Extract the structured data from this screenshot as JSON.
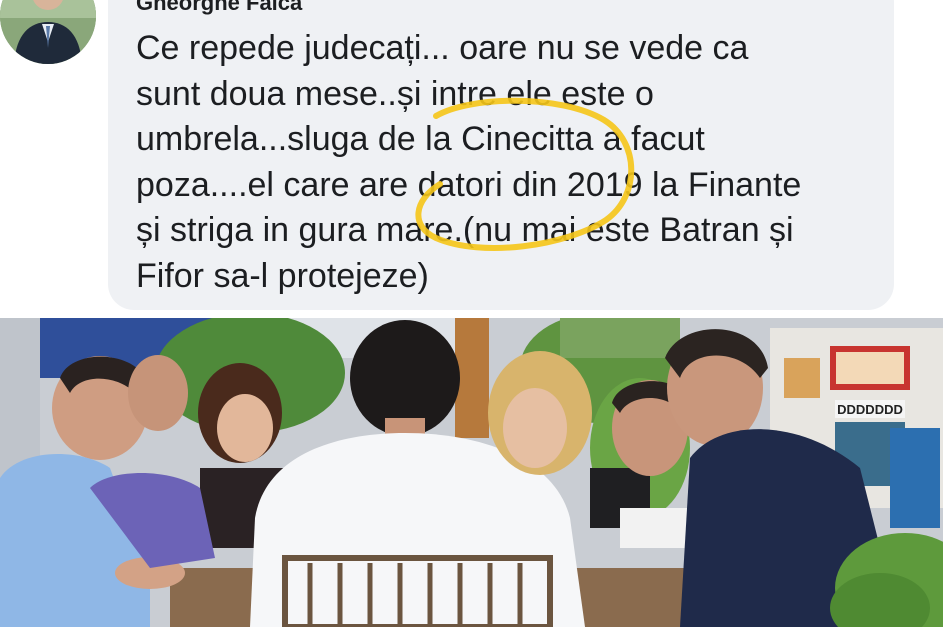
{
  "comment": {
    "author": "Gheorghe Falca",
    "lines": [
      "Ce repede judecați... oare nu se vede ca",
      "sunt doua mese..și intre ele este o",
      "umbrela...sluga de la Cinecitta a facut",
      "poza....el care are datori din 2019 la Finante",
      "și striga in gura mare.(nu mai este Batran și",
      "Fifor sa-l protejeze)"
    ],
    "highlight_color": "#f5c518"
  },
  "photo": {
    "sign_text": "DDDDDDD",
    "avatar_icon": "person-avatar-icon"
  }
}
